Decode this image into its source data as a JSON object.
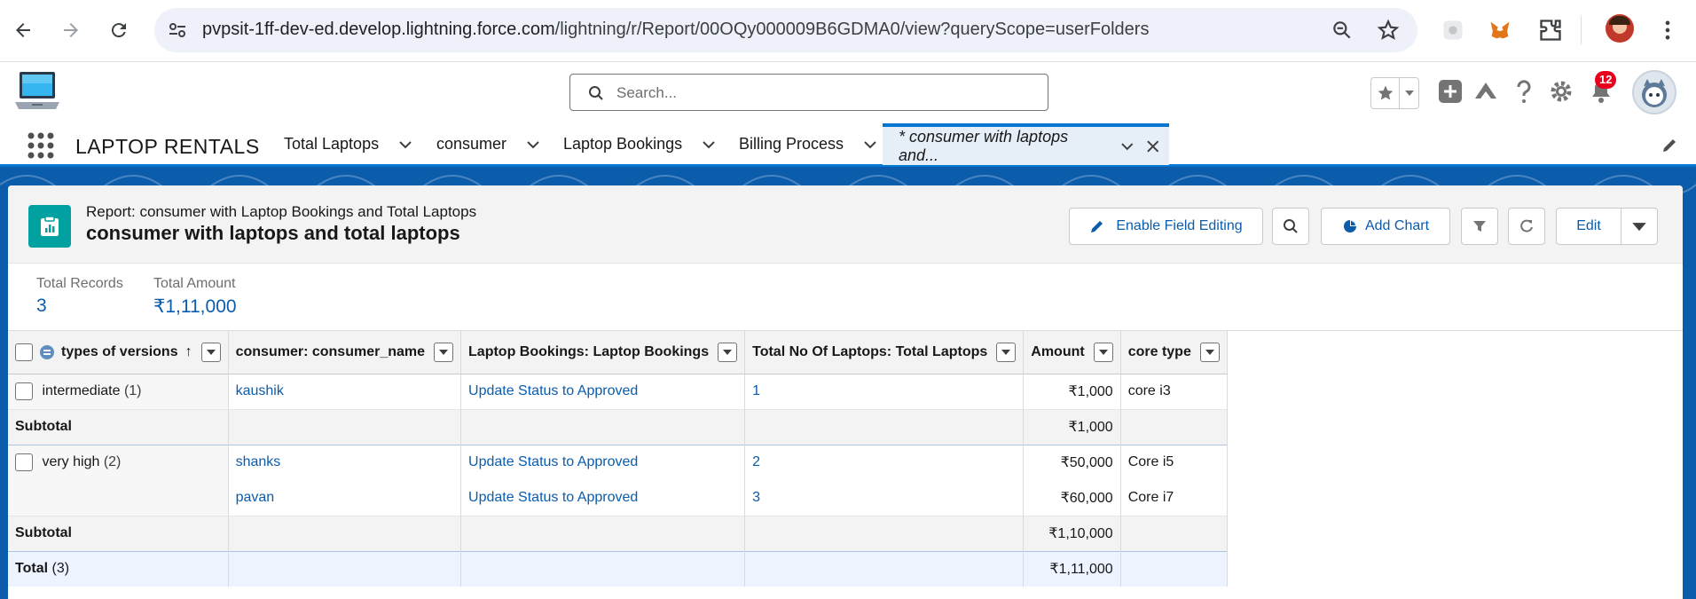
{
  "browser": {
    "url_host": "pvpsit-1ff-dev-ed.develop.lightning.force.com",
    "url_path": "/lightning/r/Report/00OQy000009B6GDMA0/view?queryScope=userFolders"
  },
  "header": {
    "search_placeholder": "Search...",
    "notifications_count": "12"
  },
  "nav": {
    "app_name": "LAPTOP RENTALS",
    "tabs": [
      {
        "label": "Total Laptops"
      },
      {
        "label": "consumer"
      },
      {
        "label": "Laptop Bookings"
      },
      {
        "label": "Billing Process"
      },
      {
        "label": "* consumer with laptops and..."
      }
    ]
  },
  "report": {
    "subtitle": "Report: consumer with Laptop Bookings and Total Laptops",
    "title": "consumer with laptops and total laptops",
    "buttons": {
      "enable_field_editing": "Enable Field Editing",
      "add_chart": "Add Chart",
      "edit": "Edit"
    },
    "summary": {
      "records_label": "Total Records",
      "records_value": "3",
      "amount_label": "Total Amount",
      "amount_value": "₹1,11,000"
    },
    "columns": [
      "types of versions",
      "consumer: consumer_name",
      "Laptop Bookings: Laptop Bookings",
      "Total No Of Laptops: Total Laptops",
      "Amount",
      "core type"
    ],
    "sort_indicator": "↑",
    "groups": [
      {
        "label": "intermediate",
        "count": "(1)",
        "rows": [
          {
            "consumer": "kaushik",
            "booking": "Update Status to Approved",
            "laptops": "1",
            "amount": "₹1,000",
            "core": "core i3"
          }
        ],
        "subtotal_label": "Subtotal",
        "subtotal_amount": "₹1,000"
      },
      {
        "label": "very high",
        "count": "(2)",
        "rows": [
          {
            "consumer": "shanks",
            "booking": "Update Status to Approved",
            "laptops": "2",
            "amount": "₹50,000",
            "core": "Core i5"
          },
          {
            "consumer": "pavan",
            "booking": "Update Status to Approved",
            "laptops": "3",
            "amount": "₹60,000",
            "core": "Core i7"
          }
        ],
        "subtotal_label": "Subtotal",
        "subtotal_amount": "₹1,10,000"
      }
    ],
    "total_label": "Total",
    "total_count": "(3)",
    "total_amount": "₹1,11,000"
  },
  "colors": {
    "brand_blue": "#0176d3",
    "link_blue": "#0b5cab",
    "report_icon": "#00a1a0"
  }
}
